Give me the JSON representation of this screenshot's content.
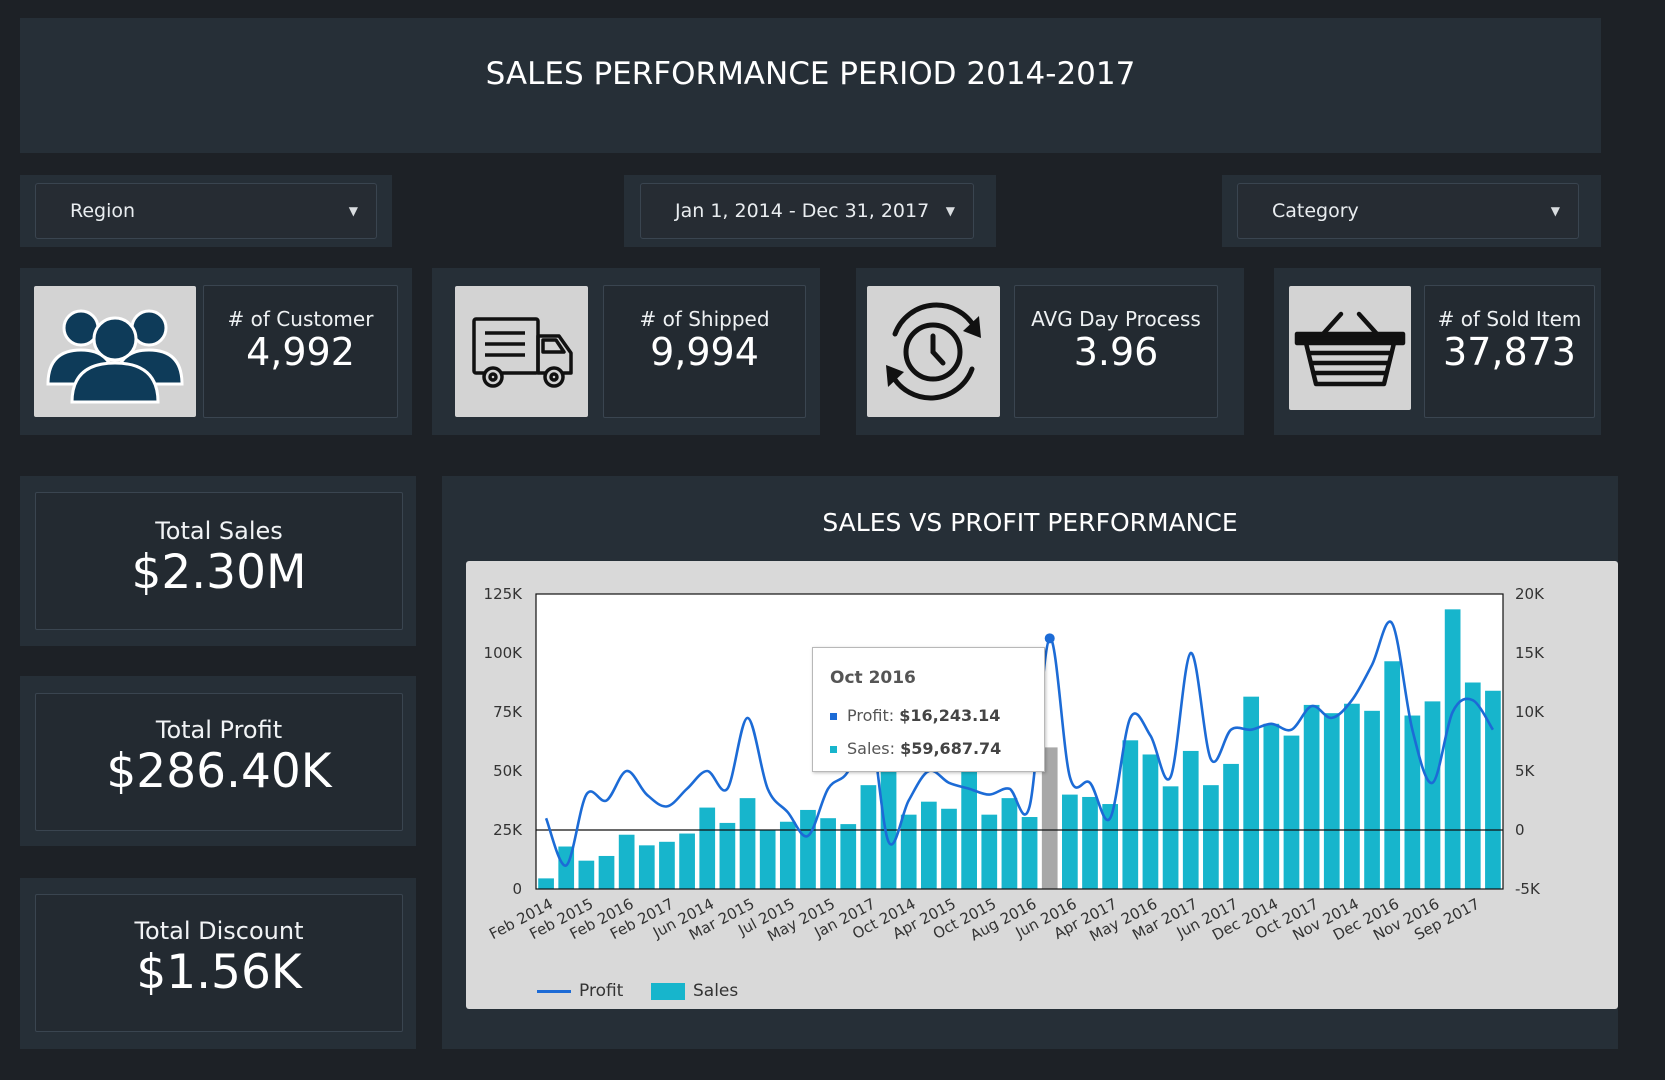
{
  "header": {
    "title": "SALES PERFORMANCE PERIOD 2014-2017"
  },
  "filters": {
    "region": {
      "label": "Region"
    },
    "date": {
      "label": "Jan 1, 2014 - Dec 31, 2017"
    },
    "category": {
      "label": "Category"
    }
  },
  "kpis": [
    {
      "label": "# of Customer",
      "value": "4,992",
      "icon": "users-icon"
    },
    {
      "label": "# of Shipped",
      "value": "9,994",
      "icon": "truck-icon"
    },
    {
      "label": "AVG Day Process",
      "value": "3.96",
      "icon": "clock-refresh-icon"
    },
    {
      "label": "# of Sold Item",
      "value": "37,873",
      "icon": "basket-icon"
    }
  ],
  "totals": [
    {
      "label": "Total Sales",
      "value": "$2.30M"
    },
    {
      "label": "Total Profit",
      "value": "$286.40K"
    },
    {
      "label": "Total Discount",
      "value": "$1.56K"
    }
  ],
  "colors": {
    "background": "#1d2126",
    "panel": "#262f37",
    "sales_bar": "#17b5cc",
    "profit_line": "#1c6bd6",
    "highlight_bar": "#a8a8a8"
  },
  "chart": {
    "title": "SALES VS PROFIT PERFORMANCE",
    "tooltip": {
      "title": "Oct 2016",
      "profit_label": "Profit:",
      "profit_value": "$16,243.14",
      "sales_label": "Sales:",
      "sales_value": "$59,687.74"
    }
  },
  "chart_data": {
    "type": "bar",
    "categories": [
      "Feb 2014",
      "Feb 2015",
      "Feb 2016",
      "Feb 2017",
      "Jun 2014",
      "Mar 2015",
      "Jul 2015",
      "May 2015",
      "Jan 2017",
      "Oct 2014",
      "Apr 2015",
      "Oct 2015",
      "Aug 2016",
      "Jun 2016",
      "Apr 2017",
      "May 2016",
      "Mar 2017",
      "Jun 2017",
      "Dec 2014",
      "Oct 2017",
      "Nov 2014",
      "Dec 2016",
      "Nov 2016",
      "Sep 2017"
    ],
    "x_tick_labels": [
      "Feb 2014",
      "Feb 2015",
      "Feb 2016",
      "Feb 2017",
      "Jun 2014",
      "Mar 2015",
      "Jul 2015",
      "May 2015",
      "Jan 2017",
      "Oct 2014",
      "Apr 2015",
      "Oct 2015",
      "Aug 2016",
      "Jun 2016",
      "Apr 2017",
      "May 2016",
      "Mar 2017",
      "Jun 2017",
      "Dec 2014",
      "Oct 2017",
      "Nov 2014",
      "Dec 2016",
      "Nov 2016",
      "Sep 2017"
    ],
    "series": [
      {
        "name": "Sales",
        "axis": "left",
        "type": "bar",
        "values": [
          4500,
          18000,
          12000,
          14000,
          23000,
          18500,
          20000,
          23500,
          34500,
          28000,
          38500,
          25000,
          28500,
          33500,
          30000,
          27500,
          44000,
          58000,
          31500,
          37000,
          34000,
          52000,
          31500,
          38500,
          30500,
          60000,
          40000,
          39000,
          36000,
          63000,
          57000,
          43500,
          58500,
          44000,
          53000,
          81500,
          70000,
          65000,
          78000,
          74500,
          78500,
          75500,
          96500,
          73500,
          79500,
          118500,
          87500,
          84000
        ]
      },
      {
        "name": "Profit",
        "axis": "right",
        "type": "line",
        "values": [
          1000,
          -3000,
          3000,
          2500,
          5000,
          3000,
          2000,
          3500,
          5000,
          3500,
          9500,
          3500,
          1500,
          -500,
          3500,
          5000,
          9500,
          -1000,
          2500,
          5000,
          4000,
          3500,
          3000,
          3500,
          2000,
          16243,
          4500,
          4000,
          1000,
          9500,
          8000,
          4500,
          15000,
          6000,
          8500,
          8500,
          9000,
          8500,
          10500,
          9500,
          11000,
          14000,
          17500,
          8500,
          4000,
          10000,
          11000,
          8500
        ]
      }
    ],
    "highlight": {
      "label": "Oct 2016",
      "index": 25
    },
    "ylim_left": [
      0,
      125000
    ],
    "yticks_left": [
      "0",
      "25K",
      "50K",
      "75K",
      "100K",
      "125K"
    ],
    "ylim_right": [
      -5000,
      20000
    ],
    "yticks_right": [
      "-5K",
      "0",
      "5K",
      "10K",
      "15K",
      "20K"
    ],
    "legend": [
      "Profit",
      "Sales"
    ],
    "legend_position": "bottom-left",
    "grid": false
  }
}
